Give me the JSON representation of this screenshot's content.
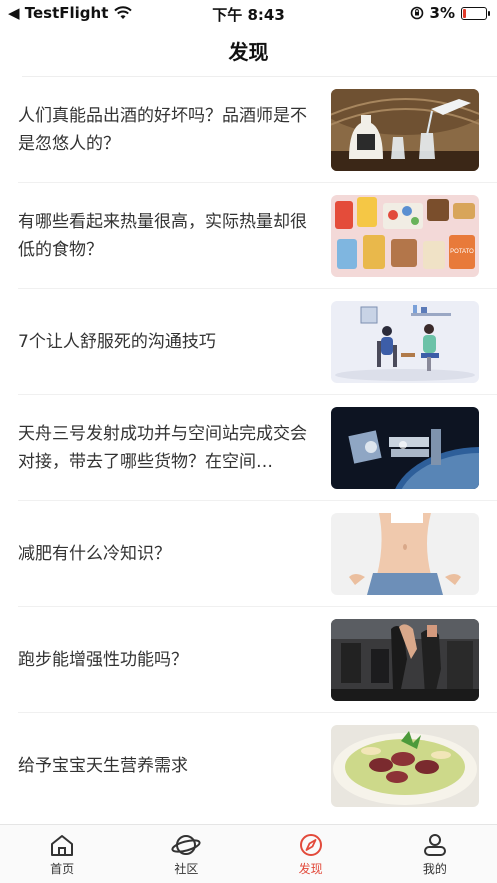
{
  "status_bar": {
    "back_app": "◀ TestFlight",
    "time": "下午 8:43",
    "battery": "3%"
  },
  "header": {
    "title": "发现"
  },
  "articles": [
    {
      "title": "人们真能品出酒的好坏吗？品酒师是不是忽悠人的？",
      "image": "liquor-bottle-cups"
    },
    {
      "title": "有哪些看起来热量很高，实际热量却很低的食物？",
      "image": "snack-foods"
    },
    {
      "title": "7个让人舒服死的沟通技巧",
      "image": "people-talking-illustration"
    },
    {
      "title": "天舟三号发射成功并与空间站完成交会对接，带去了哪些货物？在空间…",
      "image": "space-station"
    },
    {
      "title": "减肥有什么冷知识？",
      "image": "waist-measurement"
    },
    {
      "title": "跑步能增强性功能吗？",
      "image": "gym-treadmill"
    },
    {
      "title": "给予宝宝天生营养需求",
      "image": "food-bowl"
    }
  ],
  "tab_bar": {
    "active": "发现",
    "tabs": [
      {
        "label": "首页",
        "icon": "home-icon"
      },
      {
        "label": "社区",
        "icon": "planet-icon"
      },
      {
        "label": "发现",
        "icon": "compass-icon"
      },
      {
        "label": "我的",
        "icon": "profile-icon"
      }
    ]
  },
  "colors": {
    "accent": "#e24a3b",
    "text": "#333333",
    "battery_low": "#e23c2c"
  }
}
